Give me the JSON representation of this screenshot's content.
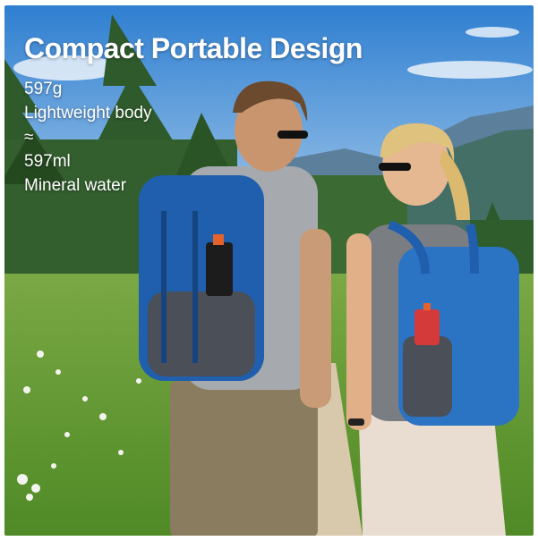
{
  "headline": "Compact Portable Design",
  "specs": [
    "597g",
    "Lightweight body",
    "≈",
    "597ml",
    "Mineral water"
  ],
  "colors": {
    "sky_top": "#2f7fd1",
    "sky_bottom": "#b9d6ee",
    "mountain": "#5c7f9c",
    "forest": "#2e5a2c",
    "meadow": "#6fa33a",
    "path": "#d8c8ac",
    "backpack_blue": "#1f5fae",
    "backpack_gray": "#4b4f57",
    "accent_orange": "#e5622a",
    "accent_red": "#d43a3a"
  }
}
